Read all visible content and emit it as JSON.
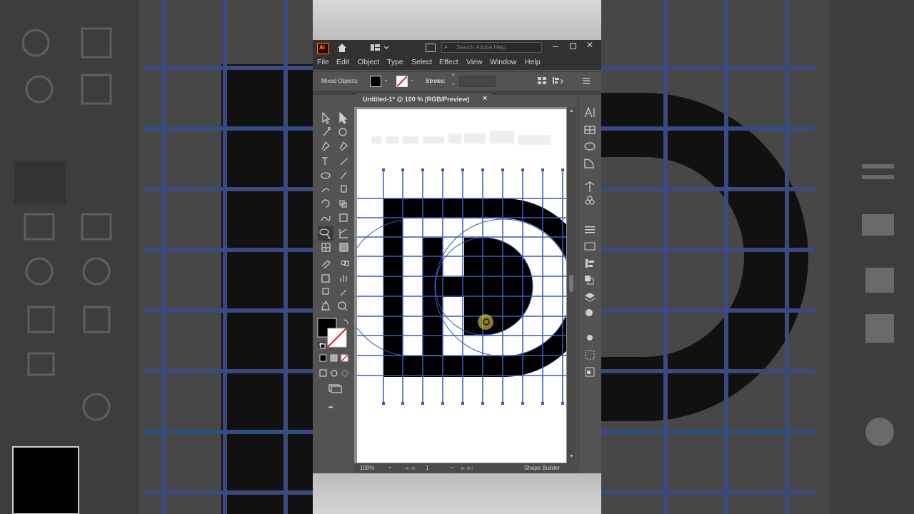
{
  "app": {
    "logo": "Ai",
    "search_placeholder": "Search Adobe Help",
    "menu": [
      "File",
      "Edit",
      "Object",
      "Type",
      "Select",
      "Effect",
      "View",
      "Window",
      "Help"
    ]
  },
  "control_bar": {
    "selection_label": "Mixed Objects",
    "stroke_label": "Stroke:"
  },
  "document": {
    "tab_title": "Untitled-1* @ 100 % (RGB/Preview)",
    "close_glyph": "×"
  },
  "status": {
    "zoom": "100%",
    "artboard_num": "1",
    "tool_name": "Shape Builder"
  },
  "toolbar": {
    "more_glyph": "•••"
  },
  "colors": {
    "accent_blue": "#3a5ab8",
    "canvas_bg": "#ffffff",
    "fill": "#000000"
  }
}
